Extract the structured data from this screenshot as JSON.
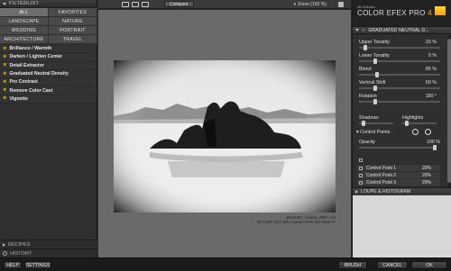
{
  "left_panel": {
    "filterlist_title": "FILTERLIST",
    "categories": [
      "ALL",
      "FAVORITES",
      "LANDSCAPE",
      "NATURE",
      "WEDDING",
      "PORTRAIT",
      "ARCHITECTURE",
      "TRAVEL"
    ],
    "active_category": "ALL",
    "filters": [
      "Brilliance / Warmth",
      "Darken / Lighten Center",
      "Detail Extractor",
      "Graduated Neutral Density",
      "Pro Contrast",
      "Remove Color Cast",
      "Vignette"
    ],
    "recipes_label": "RECIPES",
    "history_label": "HISTORY"
  },
  "toolbar": {
    "compare_label": "Compare",
    "zoom_label": "Zoom (100 %)"
  },
  "canvas": {
    "caption_line1": "2012067_Alaska_0807.nr2",
    "caption_line2": "16.0 MP, ISO 100, Canon EOS 5D Mark IV"
  },
  "right_panel": {
    "brand_small": "Nik Software",
    "brand_name": "COLOR EFEX PRO",
    "brand_version": "4",
    "filter_title": "GRADUATED NEUTRAL D...",
    "params": [
      {
        "label": "Upper Tonality",
        "value": "-15 %"
      },
      {
        "label": "Lower Tonality",
        "value": "0 %"
      },
      {
        "label": "Blend",
        "value": "85 %"
      },
      {
        "label": "Vertical Shift",
        "value": "50 %"
      },
      {
        "label": "Rotation",
        "value": "180 °"
      }
    ],
    "shadows_label": "Shadows",
    "highlights_label": "Highlights",
    "control_points_label": "Control Points",
    "opacity_label": "Opacity",
    "opacity_value": "100 %",
    "control_points": [
      {
        "name": "Control Point 1",
        "value": "20%"
      },
      {
        "name": "Control Point 2",
        "value": "20%"
      },
      {
        "name": "Control Point 3",
        "value": "20%"
      }
    ],
    "loupe_label": "LOUPE & HISTOGRAM"
  },
  "bottom_bar": {
    "help_label": "HELP",
    "settings_label": "SETTINGS",
    "brush_label": "BRUSH",
    "cancel_label": "CANCEL",
    "ok_label": "OK"
  }
}
